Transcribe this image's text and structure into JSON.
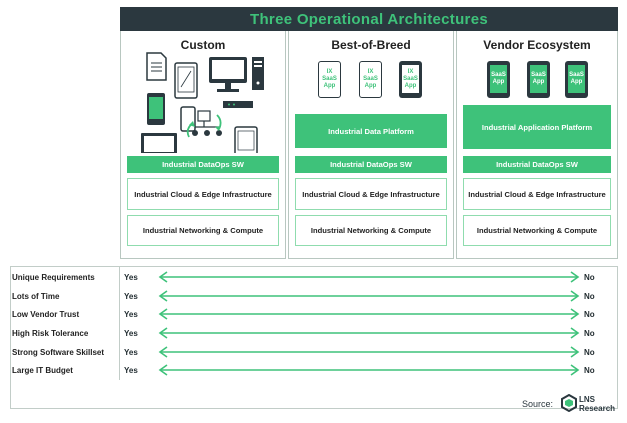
{
  "title": "Three Operational Architectures",
  "columns": [
    {
      "heading": "Custom",
      "layers": {
        "dataops": "Industrial DataOps SW",
        "cloud": "Industrial Cloud & Edge Infrastructure",
        "network": "Industrial Networking & Compute"
      }
    },
    {
      "heading": "Best-of-Breed",
      "apps": [
        "IX SaaS App",
        "IX SaaS App",
        "IX SaaS App"
      ],
      "platform": "Industrial Data Platform",
      "layers": {
        "dataops": "Industrial DataOps SW",
        "cloud": "Industrial Cloud & Edge Infrastructure",
        "network": "Industrial Networking & Compute"
      }
    },
    {
      "heading": "Vendor Ecosystem",
      "apps": [
        "SaaS App",
        "SaaS App",
        "SaaS App"
      ],
      "platform": "Industrial Application Platform",
      "layers": {
        "dataops": "Industrial DataOps SW",
        "cloud": "Industrial Cloud & Edge Infrastructure",
        "network": "Industrial Networking & Compute"
      }
    }
  ],
  "criteria": [
    {
      "label": "Unique Requirements",
      "left": "Yes",
      "right": "No"
    },
    {
      "label": "Lots of Time",
      "left": "Yes",
      "right": "No"
    },
    {
      "label": "Low Vendor Trust",
      "left": "Yes",
      "right": "No"
    },
    {
      "label": "High Risk Tolerance",
      "left": "Yes",
      "right": "No"
    },
    {
      "label": "Strong Software Skillset",
      "left": "Yes",
      "right": "No"
    },
    {
      "label": "Large IT Budget",
      "left": "Yes",
      "right": "No"
    }
  ],
  "source": {
    "label": "Source:",
    "brand_line1": "LNS",
    "brand_line2": "Research"
  },
  "colors": {
    "accent_green": "#3ec27a",
    "dark": "#2b383f",
    "light_green": "#8fdcae"
  }
}
